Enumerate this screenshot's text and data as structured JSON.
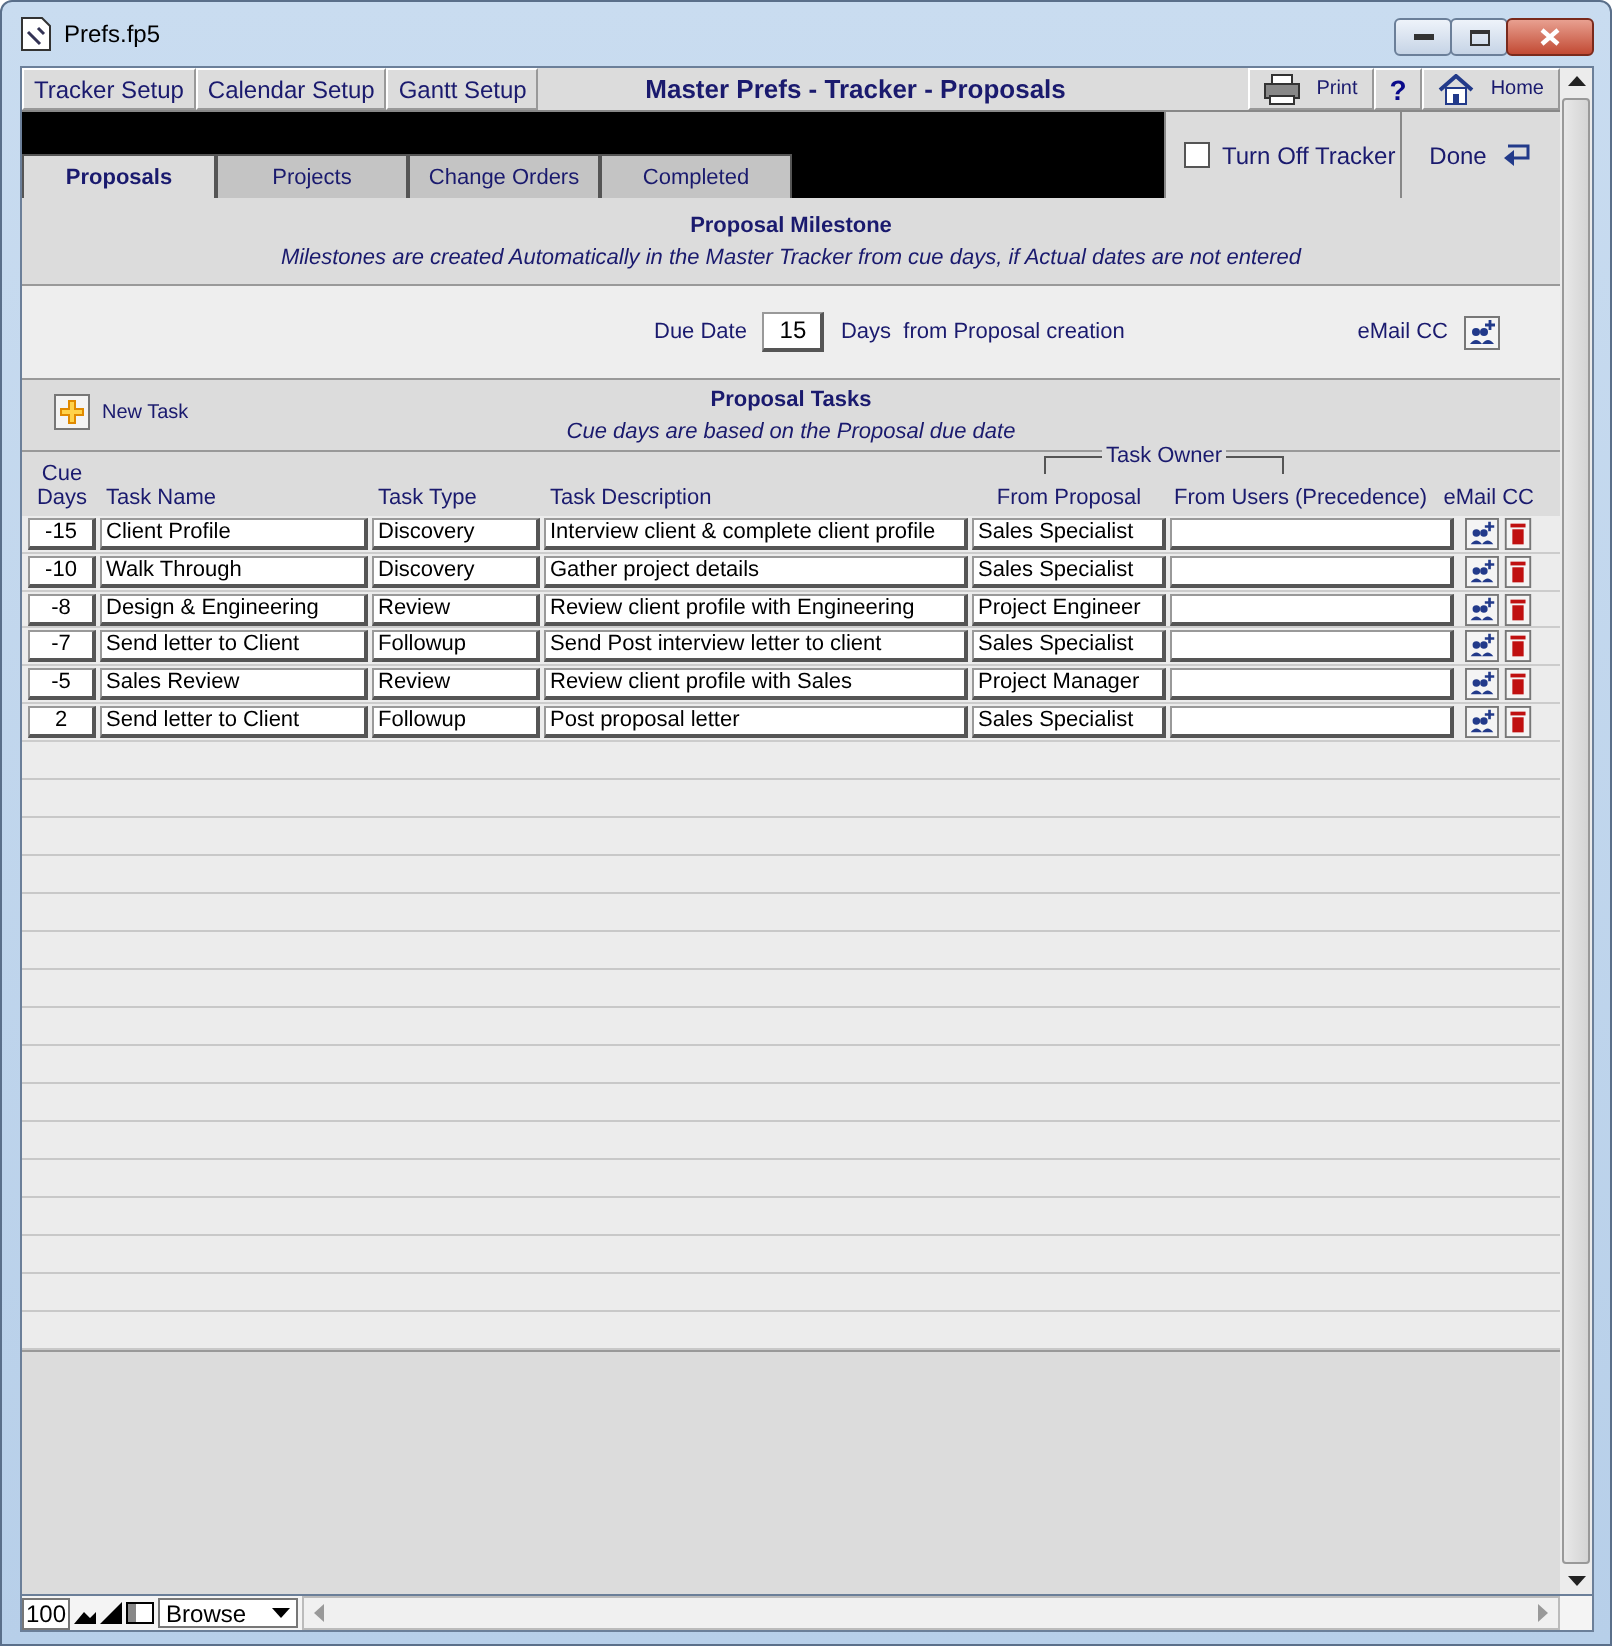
{
  "window": {
    "title": "Prefs.fp5"
  },
  "nav_buttons": [
    "Tracker Setup",
    "Calendar Setup",
    "Gantt Setup"
  ],
  "page_title": "Master Prefs - Tracker - Proposals",
  "toolbar": {
    "print": "Print",
    "help": "?",
    "home": "Home"
  },
  "tabs": [
    {
      "label": "Proposals",
      "selected": true
    },
    {
      "label": "Projects",
      "selected": false
    },
    {
      "label": "Change Orders",
      "selected": false
    },
    {
      "label": "Completed",
      "selected": false
    }
  ],
  "turn_off_tracker": {
    "label": "Turn Off Tracker",
    "checked": false
  },
  "done": "Done",
  "milestone": {
    "title": "Proposal Milestone",
    "note": "Milestones are created Automatically in the Master Tracker from cue days, if Actual dates are not entered",
    "due_label": "Due Date",
    "due_value": "15",
    "due_suffix": "Days  from Proposal creation",
    "email_label": "eMail CC"
  },
  "tasks": {
    "title": "Proposal Tasks",
    "note": "Cue days are based on the Proposal due date",
    "new_task": "New Task",
    "owner_group": "Task Owner",
    "columns": [
      "Cue\nDays",
      "Task Name",
      "Task Type",
      "Task Description",
      "From Proposal",
      "From Users (Precedence)",
      "eMail CC"
    ],
    "rows": [
      {
        "cue_days": "-15",
        "name": "Client Profile",
        "type": "Discovery",
        "description": "Interview client & complete client profile",
        "from_proposal": "Sales Specialist"
      },
      {
        "cue_days": "-10",
        "name": "Walk Through",
        "type": "Discovery",
        "description": "Gather project details",
        "from_proposal": "Sales Specialist"
      },
      {
        "cue_days": "-8",
        "name": "Design & Engineering",
        "type": "Review",
        "description": "Review client profile with Engineering",
        "from_proposal": "Project Engineer"
      },
      {
        "cue_days": "-7",
        "name": "Send letter to Client",
        "type": "Followup",
        "description": "Send Post interview letter to client",
        "from_proposal": "Sales Specialist"
      },
      {
        "cue_days": "-5",
        "name": "Sales Review",
        "type": "Review",
        "description": "Review client profile with Sales",
        "from_proposal": "Project Manager"
      },
      {
        "cue_days": "2",
        "name": "Send letter to Client",
        "type": "Followup",
        "description": "Post proposal letter",
        "from_proposal": "Sales Specialist"
      }
    ]
  },
  "status_bar": {
    "zoom": "100",
    "mode": "Browse"
  }
}
